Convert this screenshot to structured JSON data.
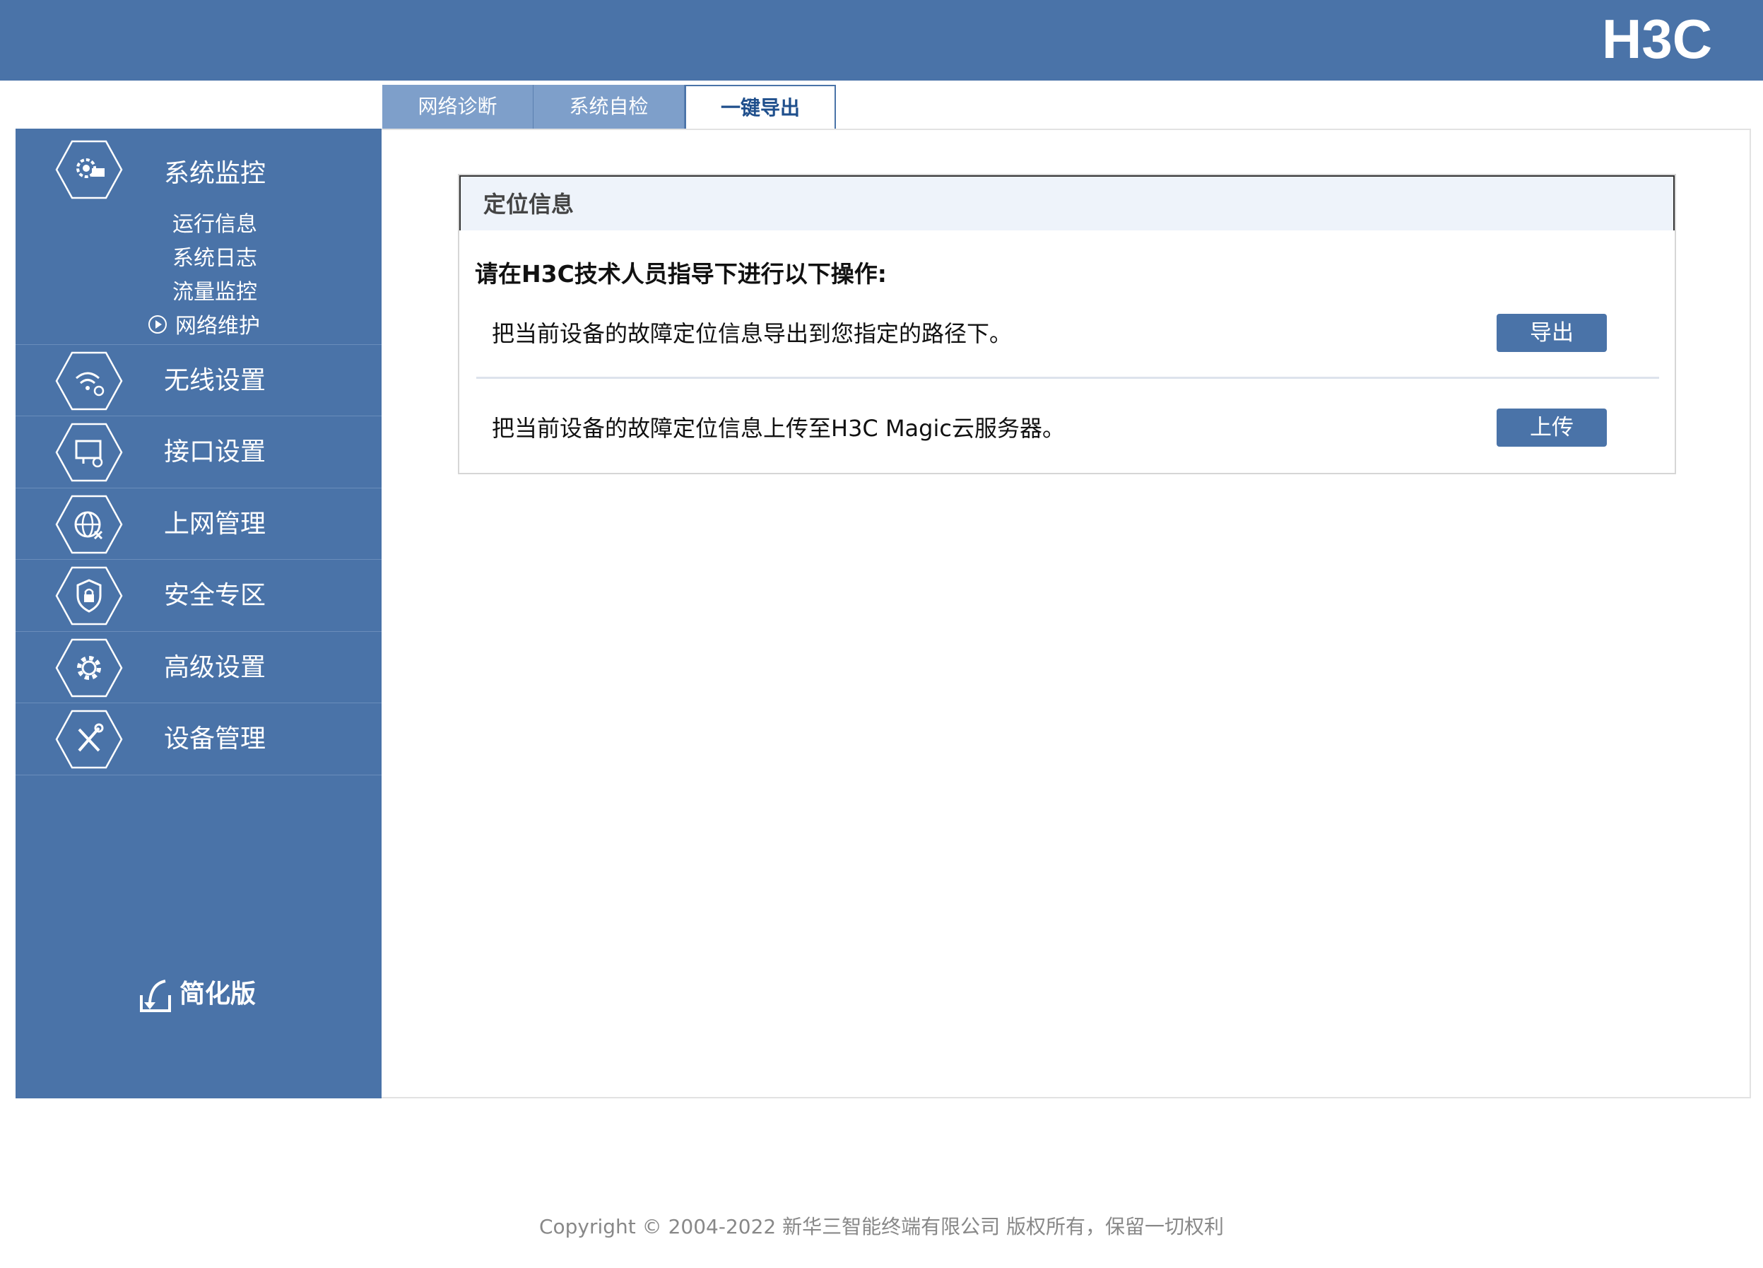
{
  "header": {
    "logo_text": "H3C"
  },
  "tabs": [
    {
      "label": "网络诊断",
      "active": false
    },
    {
      "label": "系统自检",
      "active": false
    },
    {
      "label": "一键导出",
      "active": true
    }
  ],
  "sidebar": {
    "groups": [
      {
        "label": "系统监控",
        "icon": "monitor-gear-icon",
        "items": [
          "运行信息",
          "系统日志",
          "流量监控",
          "网络维护"
        ],
        "active_item": "网络维护"
      },
      {
        "label": "无线设置",
        "icon": "wifi-gear-icon"
      },
      {
        "label": "接口设置",
        "icon": "interface-gear-icon"
      },
      {
        "label": "上网管理",
        "icon": "globe-icon"
      },
      {
        "label": "安全专区",
        "icon": "shield-lock-icon"
      },
      {
        "label": "高级设置",
        "icon": "gear-icon"
      },
      {
        "label": "设备管理",
        "icon": "tools-icon"
      }
    ],
    "simplify_label": "简化版"
  },
  "card": {
    "title": "定位信息",
    "instruction": "请在H3C技术人员指导下进行以下操作:",
    "rows": [
      {
        "text": "把当前设备的故障定位信息导出到您指定的路径下。",
        "button": "导出"
      },
      {
        "text": "把当前设备的故障定位信息上传至H3C Magic云服务器。",
        "button": "上传"
      }
    ]
  },
  "footer": {
    "copyright": "Copyright © 2004-2022 新华三智能终端有限公司 版权所有，保留一切权利"
  },
  "colors": {
    "primary": "#4a73a8",
    "tab_inactive": "#7e9fca",
    "header_bg": "#eef3fa"
  }
}
